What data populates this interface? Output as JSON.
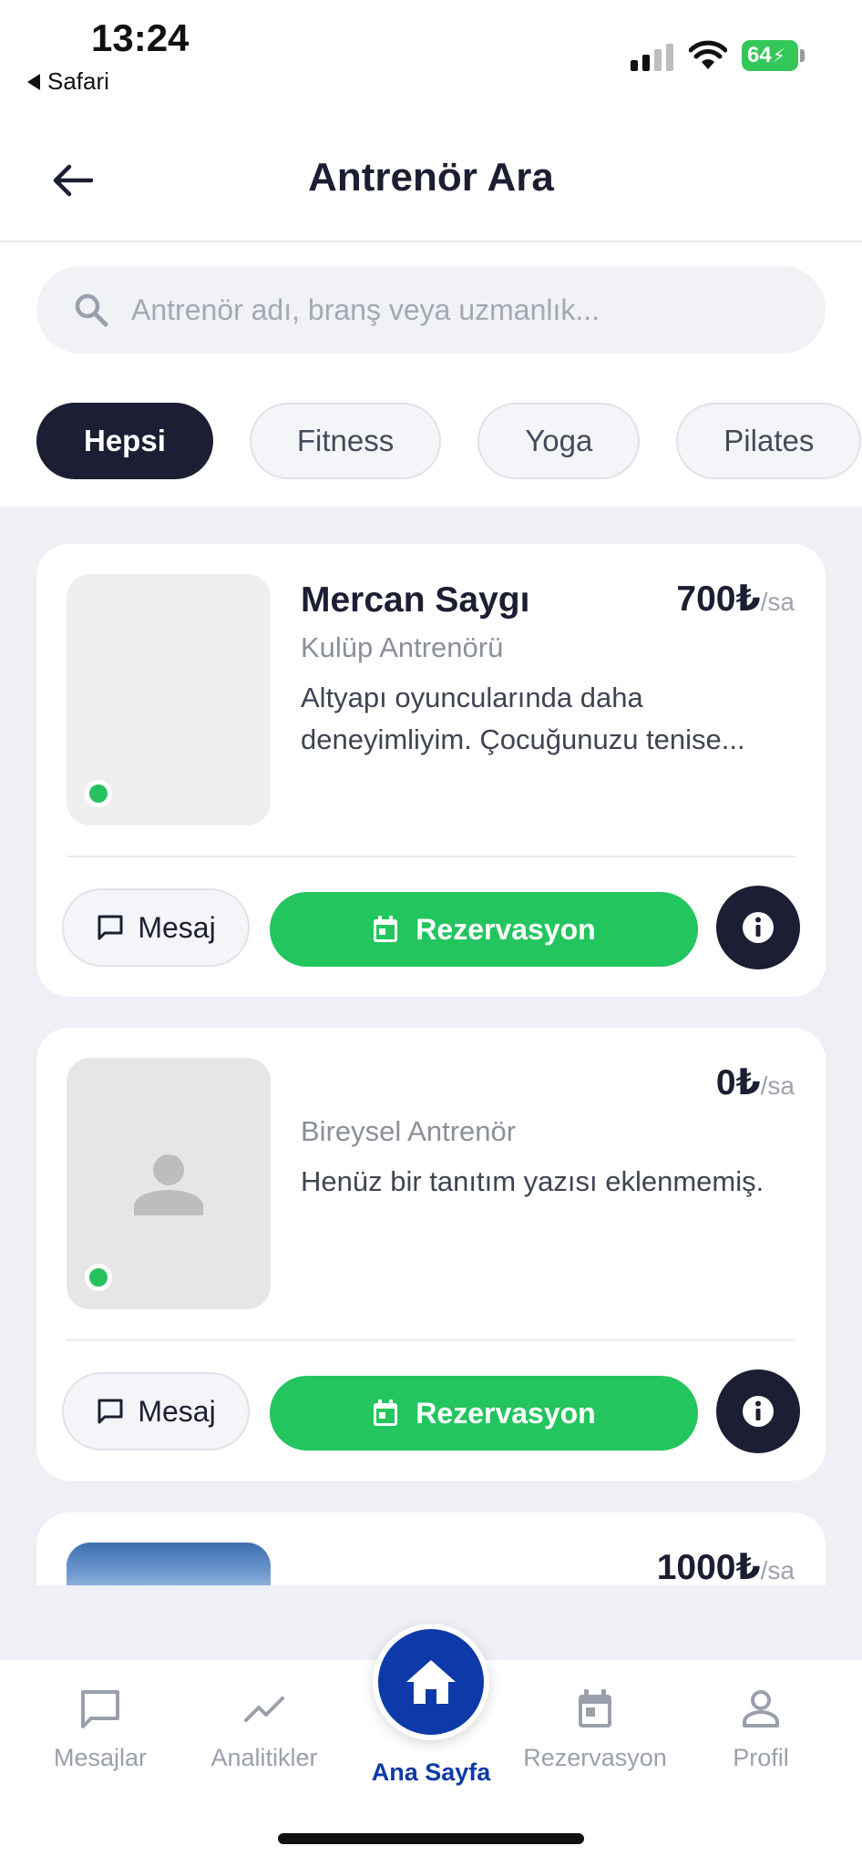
{
  "status": {
    "time": "13:24",
    "back_app": "Safari",
    "battery": "64"
  },
  "header": {
    "title": "Antrenör Ara"
  },
  "search": {
    "placeholder": "Antrenör adı, branş veya uzmanlık...",
    "value": ""
  },
  "filters": [
    "Hepsi",
    "Fitness",
    "Yoga",
    "Pilates"
  ],
  "cards": [
    {
      "name": "Mercan Saygı",
      "price": "700₺",
      "unit": "/sa",
      "role": "Kulüp Antrenörü",
      "bio": "Altyapı oyuncularında daha deneyimliyim. Çocuğunuzu tenise...",
      "message_label": "Mesaj",
      "reserve_label": "Rezervasyon"
    },
    {
      "name": "",
      "price": "0₺",
      "unit": "/sa",
      "role": "Bireysel Antrenör",
      "bio": "Henüz bir tanıtım yazısı eklenmemiş.",
      "message_label": "Mesaj",
      "reserve_label": "Rezervasyon"
    },
    {
      "price": "1000₺",
      "unit": "/sa"
    }
  ],
  "nav": {
    "messages": "Mesajlar",
    "analytics": "Analitikler",
    "home": "Ana Sayfa",
    "reservations": "Rezervasyon",
    "profile": "Profil"
  },
  "colors": {
    "primary_dark": "#1c1f33",
    "accent_green": "#22c55e",
    "online_green": "#27c15e",
    "nav_active_blue": "#0d3aa8"
  }
}
